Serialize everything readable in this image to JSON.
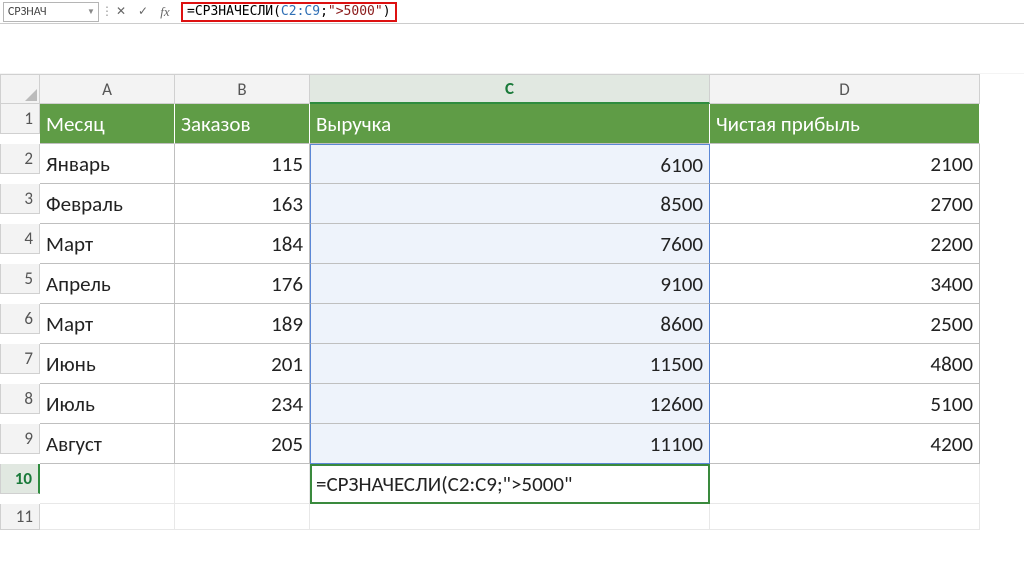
{
  "name_box": "СРЗНАЧ",
  "formula_bar": {
    "prefix": "=СРЗНАЧЕСЛИ(",
    "ref": "C2:C9",
    "sep": ";",
    "str": "\">5000\"",
    "suffix": ")"
  },
  "columns": [
    "A",
    "B",
    "C",
    "D"
  ],
  "header_row": {
    "A": "Месяц",
    "B": "Заказов",
    "C": "Выручка",
    "D": "Чистая прибыль"
  },
  "rows": [
    {
      "n": "1"
    },
    {
      "n": "2",
      "A": "Январь",
      "B": "115",
      "C": "6100",
      "D": "2100"
    },
    {
      "n": "3",
      "A": "Февраль",
      "B": "163",
      "C": "8500",
      "D": "2700"
    },
    {
      "n": "4",
      "A": "Март",
      "B": "184",
      "C": "7600",
      "D": "2200"
    },
    {
      "n": "5",
      "A": "Апрель",
      "B": "176",
      "C": "9100",
      "D": "3400"
    },
    {
      "n": "6",
      "A": "Март",
      "B": "189",
      "C": "8600",
      "D": "2500"
    },
    {
      "n": "7",
      "A": "Июнь",
      "B": "201",
      "C": "11500",
      "D": "4800"
    },
    {
      "n": "8",
      "A": "Июль",
      "B": "234",
      "C": "12600",
      "D": "5100"
    },
    {
      "n": "9",
      "A": "Август",
      "B": "205",
      "C": "11100",
      "D": "4200"
    },
    {
      "n": "10",
      "C_edit": "=СРЗНАЧЕСЛИ(C2:C9;\">5000\""
    },
    {
      "n": "11"
    }
  ],
  "row_labels": [
    "1",
    "2",
    "3",
    "4",
    "5",
    "6",
    "7",
    "8",
    "9",
    "10",
    "11"
  ]
}
